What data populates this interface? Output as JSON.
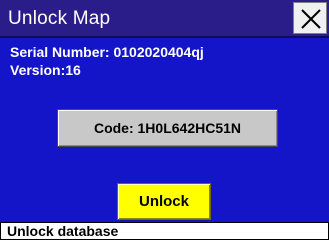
{
  "window": {
    "title": "Unlock Map"
  },
  "header": {
    "close_icon": "close-x-icon"
  },
  "info": {
    "serial_number": "Serial Number: 0102020404qj",
    "version": "Version:16"
  },
  "buttons": {
    "code_label": "Code: 1H0L642HC51N",
    "unlock_label": "Unlock"
  },
  "status": {
    "text": "Unlock database"
  },
  "colors": {
    "background": "#1414c8",
    "titlebar": "#2a1d8a",
    "unlock_button": "#ffff00",
    "code_button": "#c8c8c8"
  }
}
